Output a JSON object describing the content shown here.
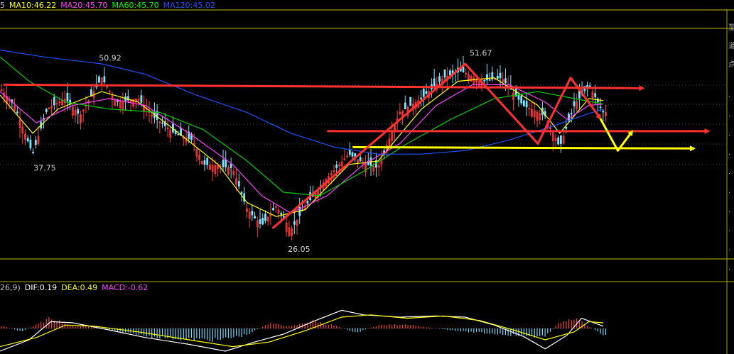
{
  "legend_top": {
    "prefix": "5",
    "items": [
      {
        "text": "MA10:46.22",
        "color": "#ffff00"
      },
      {
        "text": "MA20:45.70",
        "color": "#ff40ff"
      },
      {
        "text": "MA60:45.70",
        "color": "#00ff00"
      },
      {
        "text": "MA120:45.02",
        "color": "#2050ff"
      }
    ]
  },
  "legend_macd": {
    "prefix": "26,9)",
    "items": [
      {
        "text": "DIF:0.19",
        "color": "#ffffff"
      },
      {
        "text": "DEA:0.49",
        "color": "#ffff00"
      },
      {
        "text": "MACD:-0.62",
        "color": "#ff40ff"
      }
    ]
  },
  "right_axis_fragments": [
    "至",
    "道",
    "点"
  ],
  "chart_data": {
    "type": "candlestick_with_macd",
    "price_range": [
      24,
      56
    ],
    "annotations": [
      {
        "label": "50.92",
        "price": 50.92,
        "x_frac": 0.14
      },
      {
        "label": "37.75",
        "price": 37.75,
        "x_frac": 0.05
      },
      {
        "label": "26.05",
        "price": 26.05,
        "x_frac": 0.4
      },
      {
        "label": "51.67",
        "price": 51.67,
        "x_frac": 0.65
      }
    ],
    "close_path": [
      [
        0.0,
        48.0
      ],
      [
        0.02,
        45.5
      ],
      [
        0.045,
        38.5
      ],
      [
        0.065,
        45.0
      ],
      [
        0.09,
        46.5
      ],
      [
        0.11,
        44.0
      ],
      [
        0.14,
        49.5
      ],
      [
        0.16,
        46.0
      ],
      [
        0.19,
        46.5
      ],
      [
        0.21,
        44.0
      ],
      [
        0.24,
        41.5
      ],
      [
        0.265,
        40.5
      ],
      [
        0.28,
        37.0
      ],
      [
        0.3,
        36.8
      ],
      [
        0.32,
        36.5
      ],
      [
        0.34,
        30.5
      ],
      [
        0.36,
        28.2
      ],
      [
        0.38,
        31.0
      ],
      [
        0.4,
        27.5
      ],
      [
        0.42,
        31.0
      ],
      [
        0.45,
        35.0
      ],
      [
        0.48,
        38.5
      ],
      [
        0.5,
        37.2
      ],
      [
        0.52,
        36.5
      ],
      [
        0.55,
        44.5
      ],
      [
        0.58,
        46.5
      ],
      [
        0.61,
        49.5
      ],
      [
        0.635,
        50.5
      ],
      [
        0.66,
        49.0
      ],
      [
        0.69,
        49.5
      ],
      [
        0.72,
        45.5
      ],
      [
        0.75,
        44.0
      ],
      [
        0.77,
        39.5
      ],
      [
        0.79,
        45.5
      ],
      [
        0.81,
        48.5
      ],
      [
        0.83,
        44.5
      ]
    ],
    "ma_series": [
      {
        "name": "MA10",
        "color": "#ffff00",
        "points": [
          [
            0.0,
            47.0
          ],
          [
            0.045,
            41.5
          ],
          [
            0.08,
            45.0
          ],
          [
            0.14,
            47.5
          ],
          [
            0.19,
            46.0
          ],
          [
            0.24,
            42.0
          ],
          [
            0.3,
            37.0
          ],
          [
            0.34,
            31.5
          ],
          [
            0.38,
            29.5
          ],
          [
            0.42,
            30.5
          ],
          [
            0.48,
            37.0
          ],
          [
            0.52,
            37.5
          ],
          [
            0.58,
            45.0
          ],
          [
            0.63,
            49.0
          ],
          [
            0.68,
            49.5
          ],
          [
            0.74,
            45.5
          ],
          [
            0.77,
            41.5
          ],
          [
            0.81,
            46.5
          ],
          [
            0.83,
            46.2
          ]
        ]
      },
      {
        "name": "MA20",
        "color": "#ff40ff",
        "points": [
          [
            0.0,
            47.5
          ],
          [
            0.05,
            43.0
          ],
          [
            0.1,
            45.5
          ],
          [
            0.15,
            46.5
          ],
          [
            0.2,
            45.5
          ],
          [
            0.26,
            41.5
          ],
          [
            0.32,
            37.0
          ],
          [
            0.36,
            32.5
          ],
          [
            0.4,
            30.0
          ],
          [
            0.45,
            32.5
          ],
          [
            0.5,
            37.0
          ],
          [
            0.55,
            40.0
          ],
          [
            0.6,
            45.5
          ],
          [
            0.65,
            48.5
          ],
          [
            0.7,
            48.5
          ],
          [
            0.75,
            46.0
          ],
          [
            0.78,
            43.5
          ],
          [
            0.81,
            45.5
          ],
          [
            0.83,
            45.7
          ]
        ]
      },
      {
        "name": "MA60",
        "color": "#00cc00",
        "points": [
          [
            0.0,
            52.5
          ],
          [
            0.04,
            49.0
          ],
          [
            0.09,
            46.0
          ],
          [
            0.15,
            45.0
          ],
          [
            0.22,
            44.5
          ],
          [
            0.28,
            42.0
          ],
          [
            0.34,
            37.5
          ],
          [
            0.39,
            33.0
          ],
          [
            0.44,
            32.5
          ],
          [
            0.5,
            36.0
          ],
          [
            0.56,
            40.0
          ],
          [
            0.62,
            43.5
          ],
          [
            0.68,
            46.5
          ],
          [
            0.74,
            47.5
          ],
          [
            0.79,
            46.5
          ],
          [
            0.83,
            45.7
          ]
        ]
      },
      {
        "name": "MA120",
        "color": "#2050ff",
        "points": [
          [
            0.0,
            53.5
          ],
          [
            0.06,
            52.5
          ],
          [
            0.14,
            51.5
          ],
          [
            0.2,
            50.0
          ],
          [
            0.27,
            47.0
          ],
          [
            0.34,
            44.5
          ],
          [
            0.4,
            41.5
          ],
          [
            0.46,
            39.5
          ],
          [
            0.52,
            38.5
          ],
          [
            0.58,
            38.5
          ],
          [
            0.64,
            39.0
          ],
          [
            0.7,
            40.5
          ],
          [
            0.76,
            42.5
          ],
          [
            0.8,
            44.0
          ],
          [
            0.83,
            45.0
          ]
        ]
      }
    ],
    "overlays": [
      {
        "color": "#ff3030",
        "arrow": true,
        "points": [
          [
            0.005,
            48.5
          ],
          [
            0.885,
            48.0
          ]
        ]
      },
      {
        "color": "#ff3030",
        "arrow": true,
        "points": [
          [
            0.45,
            41.8
          ],
          [
            0.975,
            41.8
          ]
        ]
      },
      {
        "color": "#ffff00",
        "arrow": true,
        "points": [
          [
            0.485,
            39.5
          ],
          [
            0.955,
            39.3
          ]
        ]
      },
      {
        "color": "#ff3030",
        "arrow": false,
        "points": [
          [
            0.375,
            27.8
          ],
          [
            0.64,
            51.5
          ],
          [
            0.74,
            40.0
          ],
          [
            0.785,
            49.5
          ],
          [
            0.82,
            44.5
          ]
        ]
      },
      {
        "color": "#ff3030",
        "arrow": true,
        "points": [
          [
            0.82,
            44.5
          ],
          [
            0.826,
            43.6
          ]
        ]
      },
      {
        "color": "#ffff00",
        "arrow": true,
        "points": [
          [
            0.826,
            43.6
          ],
          [
            0.85,
            39.0
          ],
          [
            0.87,
            41.8
          ]
        ]
      }
    ],
    "macd": {
      "hist_env": [
        [
          0.0,
          0.3
        ],
        [
          0.03,
          -0.3
        ],
        [
          0.055,
          0.5
        ],
        [
          0.07,
          1.0
        ],
        [
          0.1,
          0.2
        ],
        [
          0.13,
          0.3
        ],
        [
          0.16,
          -0.3
        ],
        [
          0.2,
          -0.7
        ],
        [
          0.25,
          -1.0
        ],
        [
          0.3,
          -1.1
        ],
        [
          0.34,
          -0.6
        ],
        [
          0.37,
          0.5
        ],
        [
          0.4,
          0.2
        ],
        [
          0.43,
          0.7
        ],
        [
          0.46,
          0.3
        ],
        [
          0.49,
          -0.4
        ],
        [
          0.52,
          0.3
        ],
        [
          0.56,
          0.4
        ],
        [
          0.6,
          0.0
        ],
        [
          0.64,
          -0.3
        ],
        [
          0.68,
          -0.5
        ],
        [
          0.72,
          -0.7
        ],
        [
          0.75,
          -0.8
        ],
        [
          0.77,
          0.6
        ],
        [
          0.79,
          1.0
        ],
        [
          0.81,
          0.2
        ],
        [
          0.83,
          -0.6
        ]
      ],
      "dif": [
        [
          0.0,
          -2.0
        ],
        [
          0.04,
          -1.0
        ],
        [
          0.07,
          0.6
        ],
        [
          0.1,
          0.5
        ],
        [
          0.14,
          0.0
        ],
        [
          0.2,
          -0.8
        ],
        [
          0.26,
          -1.4
        ],
        [
          0.31,
          -2.0
        ],
        [
          0.35,
          -1.2
        ],
        [
          0.39,
          -0.5
        ],
        [
          0.43,
          0.6
        ],
        [
          0.47,
          1.6
        ],
        [
          0.5,
          1.2
        ],
        [
          0.55,
          1.0
        ],
        [
          0.6,
          1.1
        ],
        [
          0.64,
          1.0
        ],
        [
          0.68,
          0.3
        ],
        [
          0.72,
          -0.7
        ],
        [
          0.75,
          -1.8
        ],
        [
          0.78,
          -0.6
        ],
        [
          0.8,
          0.9
        ],
        [
          0.83,
          0.2
        ]
      ],
      "dea": [
        [
          0.0,
          -1.6
        ],
        [
          0.05,
          -0.8
        ],
        [
          0.09,
          0.3
        ],
        [
          0.13,
          0.2
        ],
        [
          0.19,
          -0.3
        ],
        [
          0.26,
          -1.0
        ],
        [
          0.32,
          -1.6
        ],
        [
          0.37,
          -1.2
        ],
        [
          0.42,
          -0.2
        ],
        [
          0.47,
          1.0
        ],
        [
          0.51,
          1.2
        ],
        [
          0.56,
          0.9
        ],
        [
          0.61,
          1.1
        ],
        [
          0.66,
          0.7
        ],
        [
          0.71,
          -0.2
        ],
        [
          0.75,
          -1.0
        ],
        [
          0.79,
          -0.3
        ],
        [
          0.81,
          0.6
        ],
        [
          0.83,
          0.5
        ]
      ]
    }
  }
}
